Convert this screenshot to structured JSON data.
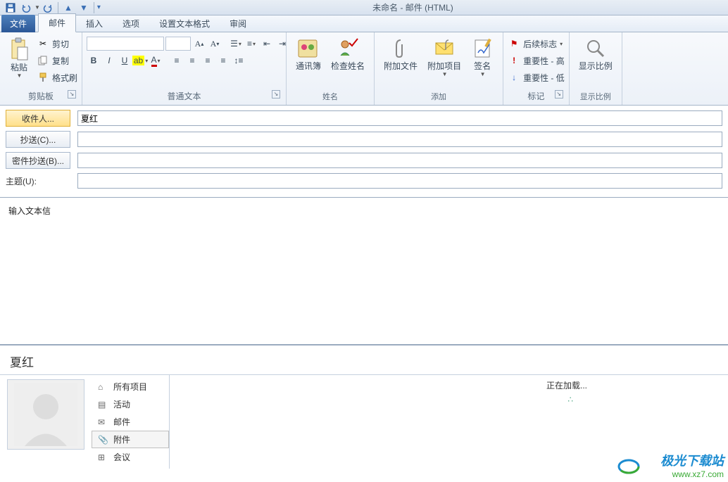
{
  "window": {
    "title": "未命名 - 邮件 (HTML)"
  },
  "tabs": {
    "file": "文件",
    "items": [
      "邮件",
      "插入",
      "选项",
      "设置文本格式",
      "审阅"
    ],
    "active": 0
  },
  "ribbon": {
    "clipboard": {
      "paste": "粘贴",
      "cut": "剪切",
      "copy": "复制",
      "format_painter": "格式刷",
      "label": "剪贴板"
    },
    "font": {
      "label": "普通文本"
    },
    "names": {
      "address_book": "通讯簿",
      "check_names": "检查姓名",
      "label": "姓名"
    },
    "include": {
      "attach_file": "附加文件",
      "attach_item": "附加项目",
      "signature": "签名",
      "label": "添加"
    },
    "tags": {
      "followup": "后续标志",
      "high": "重要性 - 高",
      "low": "重要性 - 低",
      "label": "标记"
    },
    "zoom": {
      "btn": "显示比例",
      "label": "显示比例"
    }
  },
  "compose": {
    "to_btn": "收件人...",
    "to_value": "夏红",
    "cc_btn": "抄送(C)...",
    "cc_value": "",
    "bcc_btn": "密件抄送(B)...",
    "bcc_value": "",
    "subject_label": "主题(U):",
    "subject_value": "",
    "body": "输入文本信"
  },
  "people_pane": {
    "name": "夏红",
    "nav": [
      "所有项目",
      "活动",
      "邮件",
      "附件",
      "会议"
    ],
    "selected": 3,
    "loading": "正在加载..."
  },
  "watermark": {
    "line1": "极光下载站",
    "line2": "www.xz7.com"
  }
}
